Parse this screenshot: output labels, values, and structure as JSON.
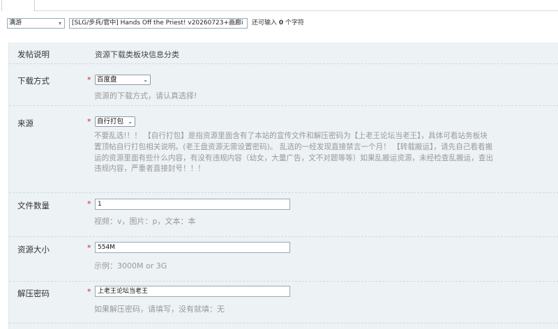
{
  "title_bar": {
    "category": "满游",
    "title_value": "[SLG/步兵/官中] Hands Off the Priest! v20260723+画廊i",
    "remaining_prefix": "还可输入 ",
    "remaining_count": "0",
    "remaining_suffix": " 个字符"
  },
  "form": {
    "header": {
      "label": "发帖说明",
      "description": "资源下载类板块信息分类"
    },
    "download_method": {
      "label": "下载方式",
      "required_mark": "*",
      "selected": "百度盘",
      "hint": "资源的下载方式，请认真选择!"
    },
    "source": {
      "label": "来源",
      "required_mark": "*",
      "selected": "自行打包",
      "hint_lines": [
        "不要乱选!！！ 【自行打包】是指资源里面含有了本站的宣传文件和解压密码为【上老王论坛当老王】，具体可看站务板块",
        "置顶帖自行打包相关说明。(老王盘资源无需设置密码)。 乱选的一经发现直接禁言一个月！ 【转载搬运】，请先自己看看搬",
        "运的资源里面有些什么内容，有没有违规内容（幼女，大量广告，文不对题等等）如果乱搬运资源，未经检查乱搬运，查出",
        "违规内容，严重者直接封号！！！"
      ]
    },
    "file_count": {
      "label": "文件数量",
      "required_mark": "*",
      "value": "1",
      "hint": "视频：v，图片：p，文本：本"
    },
    "size": {
      "label": "资源大小",
      "required_mark": "*",
      "value": "554M",
      "hint": "示例：3000M or 3G"
    },
    "password": {
      "label": "解压密码",
      "required_mark": "*",
      "value": "上老王论坛当老王",
      "hint": "如果解压密码，请填写，没有就填：无"
    }
  }
}
